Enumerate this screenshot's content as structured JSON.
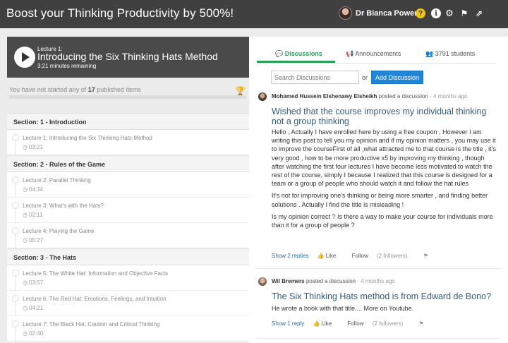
{
  "header": {
    "title": "Boost your Thinking Productivity by 500%!",
    "user_name": "Dr Bianca Power",
    "icons": [
      "help-icon",
      "info-icon",
      "gear-icon",
      "flag-icon",
      "share-icon"
    ]
  },
  "player": {
    "lecture_number": "Lecture 1:",
    "lecture_title": "Introducing the Six Thinking Hats Method",
    "remaining": "3:21 minutes remaining"
  },
  "progress": {
    "prefix": "You have not started any of",
    "count": "17",
    "suffix": "published items",
    "fraction": 0
  },
  "curriculum": {
    "sections": [
      {
        "title": "Section: 1 - Introduction",
        "lectures": [
          {
            "title": "Lecture 1: Introducing the Six Thinking Hats Method",
            "duration": "03:21"
          }
        ]
      },
      {
        "title": "Section: 2 - Rules of the Game",
        "lectures": [
          {
            "title": "Lecture 2: Parallel Thinking",
            "duration": "04:34"
          },
          {
            "title": "Lecture 3: What's with the Hats?",
            "duration": "02:11"
          },
          {
            "title": "Lecture 4: Playing the Game",
            "duration": "05:27"
          }
        ]
      },
      {
        "title": "Section: 3 - The Hats",
        "lectures": [
          {
            "title": "Lecture 5: The White Hat: Information and Objective Facts",
            "duration": "03:57"
          },
          {
            "title": "Lecture 6: The Red Hat: Emotions, Feelings, and Intuition",
            "duration": "04:21"
          },
          {
            "title": "Lecture 7: The Black Hat: Caution and Critical Thinking",
            "duration": "02:40"
          }
        ]
      }
    ]
  },
  "tabs": {
    "discussions": "Discussions",
    "announcements": "Announcements",
    "students": "3791 students"
  },
  "search": {
    "placeholder": "Search Discussions",
    "or": "or",
    "add_label": "Add Discussion"
  },
  "posts": [
    {
      "author": "Mohamed Hussein Elshenawy Elsheikh",
      "action": "posted a discussion",
      "time": "· 4 months ago",
      "title": "Wished that the course improves my individual thinking not a group thinking",
      "paragraphs": [
        "Hello , Actually I have enrolled here by using a free coupon , However I am writing this post to tell you my opinion and if my opinion matters , you may use it to improve the courseFirst of all ,what attracted me to that course is the title , it's very good , how to be more productive x5 by improving my thinking , though after watching the first four lectures I have become less motivated to watch the rest of the course, simply I because I realized that this course is designed for a team or a group of people who should watch it and follow the hat rules",
        "It's not for improving one's thinking or being more smarter , and finding better solutions . Actually I find the title is misleading !",
        "Is my opinion correct ? Is there a way to make your course for individuals more than it for a group of people ?"
      ],
      "replies": "Show 2 replies",
      "like": "Like",
      "follow": "Follow",
      "followers": "(2 followers)"
    },
    {
      "author": "Wil Bremers",
      "action": "posted a discussion",
      "time": "· 4 months ago",
      "title": "The Six Thinking Hats method is from Edward de Bono?",
      "paragraphs": [
        "He wrote a book with that title.... More on Youtube."
      ],
      "replies": "Show 1 reply",
      "like": "Like",
      "follow": "Follow",
      "followers": "(2 followers)"
    }
  ]
}
